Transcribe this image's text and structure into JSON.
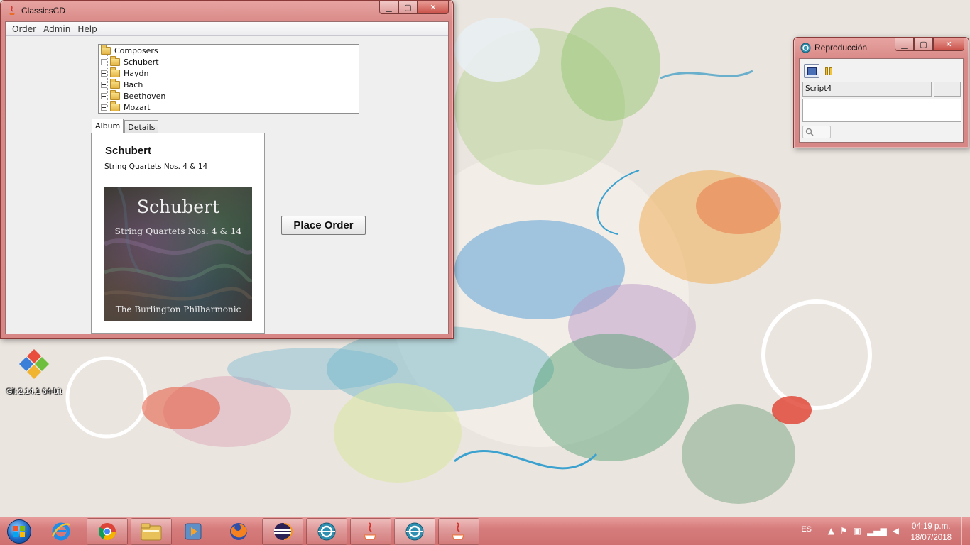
{
  "classics_window": {
    "title": "ClassicsCD",
    "menu": [
      "Order",
      "Admin",
      "Help"
    ],
    "tree": {
      "root": "Composers",
      "children": [
        "Schubert",
        "Haydn",
        "Bach",
        "Beethoven",
        "Mozart"
      ]
    },
    "tabs": [
      "Album",
      "Details"
    ],
    "active_tab": "Album",
    "album": {
      "composer": "Schubert",
      "title": "String Quartets Nos. 4 & 14",
      "cover": {
        "composer": "Schubert",
        "title": "String Quartets Nos. 4 & 14",
        "artist": "The Burlington Philharmonic"
      }
    },
    "place_order_label": "Place Order"
  },
  "repro_window": {
    "title": "Reproducción",
    "script_value": "Script4"
  },
  "desktop": {
    "icons": [
      {
        "label": "Git 2.14.1 64-bit",
        "icon": "git-icon"
      }
    ]
  },
  "taskbar": {
    "apps": [
      "internet-explorer-icon",
      "chrome-icon",
      "file-explorer-icon",
      "media-player-icon",
      "firefox-icon",
      "eclipse-icon",
      "steering-wheel-app-icon",
      "java-icon",
      "steering-wheel-app-icon",
      "java-icon"
    ],
    "language": "ES",
    "time": "04:19 p.m.",
    "date": "18/07/2018"
  },
  "colors": {
    "window_frame": "#d98a88",
    "taskbar": "#d67c7c"
  }
}
